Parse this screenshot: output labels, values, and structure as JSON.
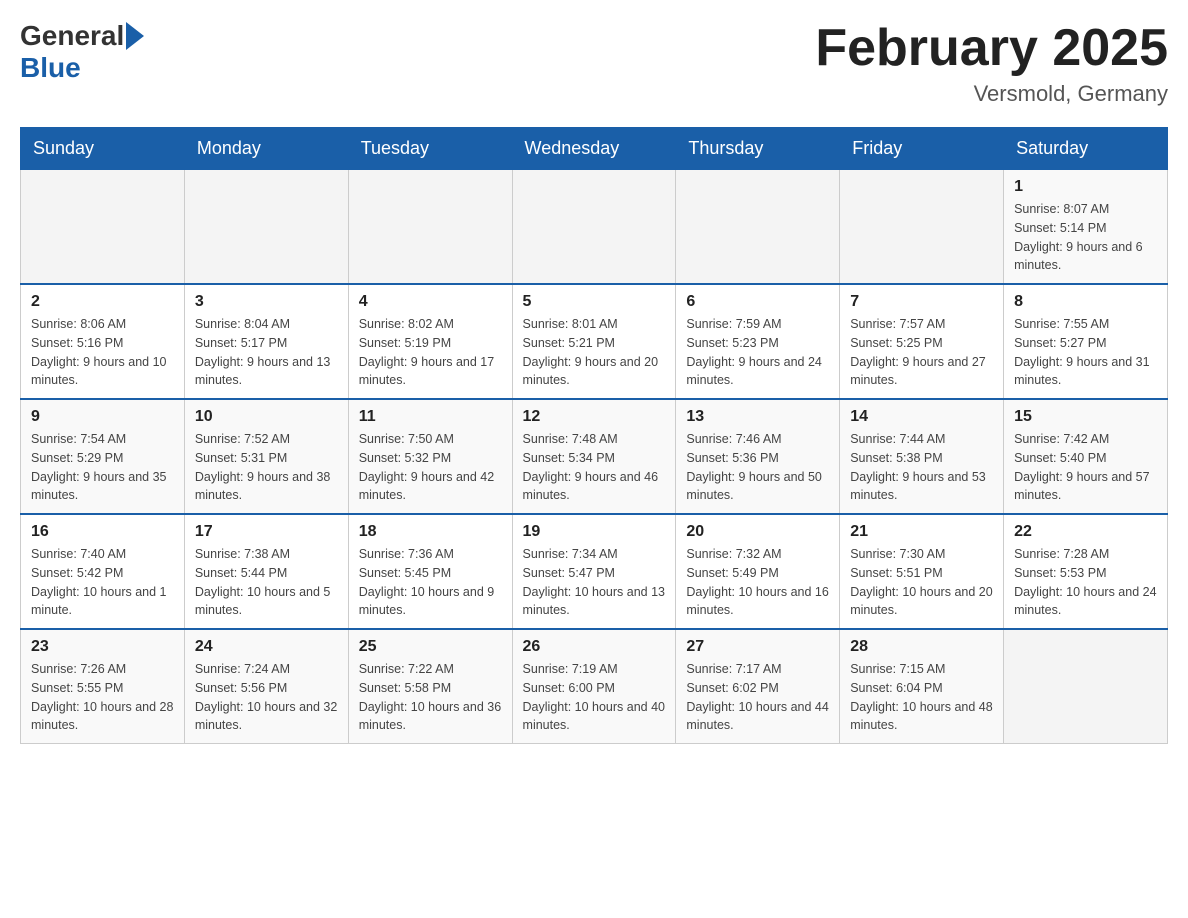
{
  "header": {
    "logo_general": "General",
    "logo_blue": "Blue",
    "month_title": "February 2025",
    "location": "Versmold, Germany"
  },
  "days_of_week": [
    "Sunday",
    "Monday",
    "Tuesday",
    "Wednesday",
    "Thursday",
    "Friday",
    "Saturday"
  ],
  "weeks": [
    [
      {
        "day": "",
        "info": ""
      },
      {
        "day": "",
        "info": ""
      },
      {
        "day": "",
        "info": ""
      },
      {
        "day": "",
        "info": ""
      },
      {
        "day": "",
        "info": ""
      },
      {
        "day": "",
        "info": ""
      },
      {
        "day": "1",
        "info": "Sunrise: 8:07 AM\nSunset: 5:14 PM\nDaylight: 9 hours and 6 minutes."
      }
    ],
    [
      {
        "day": "2",
        "info": "Sunrise: 8:06 AM\nSunset: 5:16 PM\nDaylight: 9 hours and 10 minutes."
      },
      {
        "day": "3",
        "info": "Sunrise: 8:04 AM\nSunset: 5:17 PM\nDaylight: 9 hours and 13 minutes."
      },
      {
        "day": "4",
        "info": "Sunrise: 8:02 AM\nSunset: 5:19 PM\nDaylight: 9 hours and 17 minutes."
      },
      {
        "day": "5",
        "info": "Sunrise: 8:01 AM\nSunset: 5:21 PM\nDaylight: 9 hours and 20 minutes."
      },
      {
        "day": "6",
        "info": "Sunrise: 7:59 AM\nSunset: 5:23 PM\nDaylight: 9 hours and 24 minutes."
      },
      {
        "day": "7",
        "info": "Sunrise: 7:57 AM\nSunset: 5:25 PM\nDaylight: 9 hours and 27 minutes."
      },
      {
        "day": "8",
        "info": "Sunrise: 7:55 AM\nSunset: 5:27 PM\nDaylight: 9 hours and 31 minutes."
      }
    ],
    [
      {
        "day": "9",
        "info": "Sunrise: 7:54 AM\nSunset: 5:29 PM\nDaylight: 9 hours and 35 minutes."
      },
      {
        "day": "10",
        "info": "Sunrise: 7:52 AM\nSunset: 5:31 PM\nDaylight: 9 hours and 38 minutes."
      },
      {
        "day": "11",
        "info": "Sunrise: 7:50 AM\nSunset: 5:32 PM\nDaylight: 9 hours and 42 minutes."
      },
      {
        "day": "12",
        "info": "Sunrise: 7:48 AM\nSunset: 5:34 PM\nDaylight: 9 hours and 46 minutes."
      },
      {
        "day": "13",
        "info": "Sunrise: 7:46 AM\nSunset: 5:36 PM\nDaylight: 9 hours and 50 minutes."
      },
      {
        "day": "14",
        "info": "Sunrise: 7:44 AM\nSunset: 5:38 PM\nDaylight: 9 hours and 53 minutes."
      },
      {
        "day": "15",
        "info": "Sunrise: 7:42 AM\nSunset: 5:40 PM\nDaylight: 9 hours and 57 minutes."
      }
    ],
    [
      {
        "day": "16",
        "info": "Sunrise: 7:40 AM\nSunset: 5:42 PM\nDaylight: 10 hours and 1 minute."
      },
      {
        "day": "17",
        "info": "Sunrise: 7:38 AM\nSunset: 5:44 PM\nDaylight: 10 hours and 5 minutes."
      },
      {
        "day": "18",
        "info": "Sunrise: 7:36 AM\nSunset: 5:45 PM\nDaylight: 10 hours and 9 minutes."
      },
      {
        "day": "19",
        "info": "Sunrise: 7:34 AM\nSunset: 5:47 PM\nDaylight: 10 hours and 13 minutes."
      },
      {
        "day": "20",
        "info": "Sunrise: 7:32 AM\nSunset: 5:49 PM\nDaylight: 10 hours and 16 minutes."
      },
      {
        "day": "21",
        "info": "Sunrise: 7:30 AM\nSunset: 5:51 PM\nDaylight: 10 hours and 20 minutes."
      },
      {
        "day": "22",
        "info": "Sunrise: 7:28 AM\nSunset: 5:53 PM\nDaylight: 10 hours and 24 minutes."
      }
    ],
    [
      {
        "day": "23",
        "info": "Sunrise: 7:26 AM\nSunset: 5:55 PM\nDaylight: 10 hours and 28 minutes."
      },
      {
        "day": "24",
        "info": "Sunrise: 7:24 AM\nSunset: 5:56 PM\nDaylight: 10 hours and 32 minutes."
      },
      {
        "day": "25",
        "info": "Sunrise: 7:22 AM\nSunset: 5:58 PM\nDaylight: 10 hours and 36 minutes."
      },
      {
        "day": "26",
        "info": "Sunrise: 7:19 AM\nSunset: 6:00 PM\nDaylight: 10 hours and 40 minutes."
      },
      {
        "day": "27",
        "info": "Sunrise: 7:17 AM\nSunset: 6:02 PM\nDaylight: 10 hours and 44 minutes."
      },
      {
        "day": "28",
        "info": "Sunrise: 7:15 AM\nSunset: 6:04 PM\nDaylight: 10 hours and 48 minutes."
      },
      {
        "day": "",
        "info": ""
      }
    ]
  ]
}
